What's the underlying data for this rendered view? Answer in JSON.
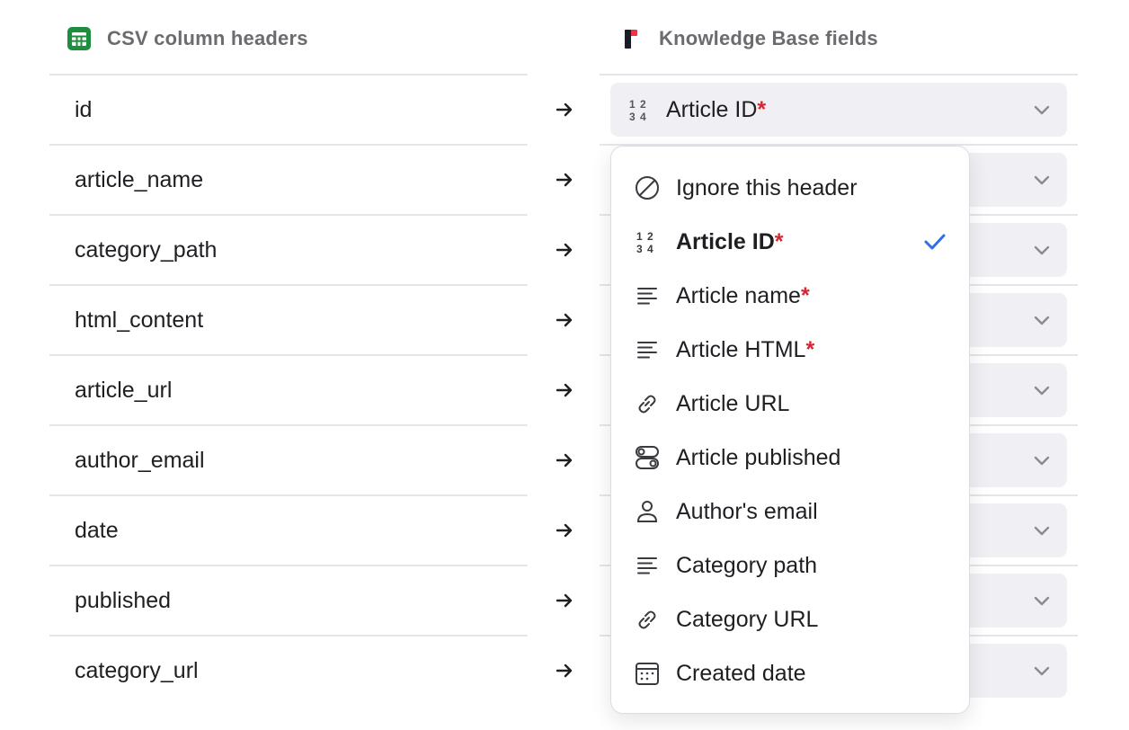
{
  "headers": {
    "csv": "CSV column headers",
    "kb": "Knowledge Base fields"
  },
  "rows": [
    {
      "csv": "id"
    },
    {
      "csv": "article_name"
    },
    {
      "csv": "category_path"
    },
    {
      "csv": "html_content"
    },
    {
      "csv": "article_url"
    },
    {
      "csv": "author_email"
    },
    {
      "csv": "date"
    },
    {
      "csv": "published"
    },
    {
      "csv": "category_url"
    }
  ],
  "mapping_select": {
    "value": "Article ID",
    "required_mark": "*",
    "icon": "numbers-icon"
  },
  "dropdown": {
    "options": [
      {
        "label": "Ignore this header",
        "required": false,
        "icon": "ban-icon"
      },
      {
        "label": "Article ID",
        "required": true,
        "icon": "numbers-icon",
        "selected": true
      },
      {
        "label": "Article name",
        "required": true,
        "icon": "text-lines-icon"
      },
      {
        "label": "Article HTML",
        "required": true,
        "icon": "text-lines-icon"
      },
      {
        "label": "Article URL",
        "required": false,
        "icon": "link-icon"
      },
      {
        "label": "Article published",
        "required": false,
        "icon": "toggle-icon"
      },
      {
        "label": "Author's email",
        "required": false,
        "icon": "person-icon"
      },
      {
        "label": "Category path",
        "required": false,
        "icon": "text-lines-icon"
      },
      {
        "label": "Category URL",
        "required": false,
        "icon": "link-icon"
      },
      {
        "label": "Created date",
        "required": false,
        "icon": "calendar-icon"
      }
    ],
    "required_mark": "*"
  },
  "colors": {
    "accent_check": "#2f6fe4",
    "required": "#d9252f",
    "sheets_green": "#1e8e3e",
    "brand_red": "#e8344a",
    "select_bg": "#f0f0f4"
  }
}
